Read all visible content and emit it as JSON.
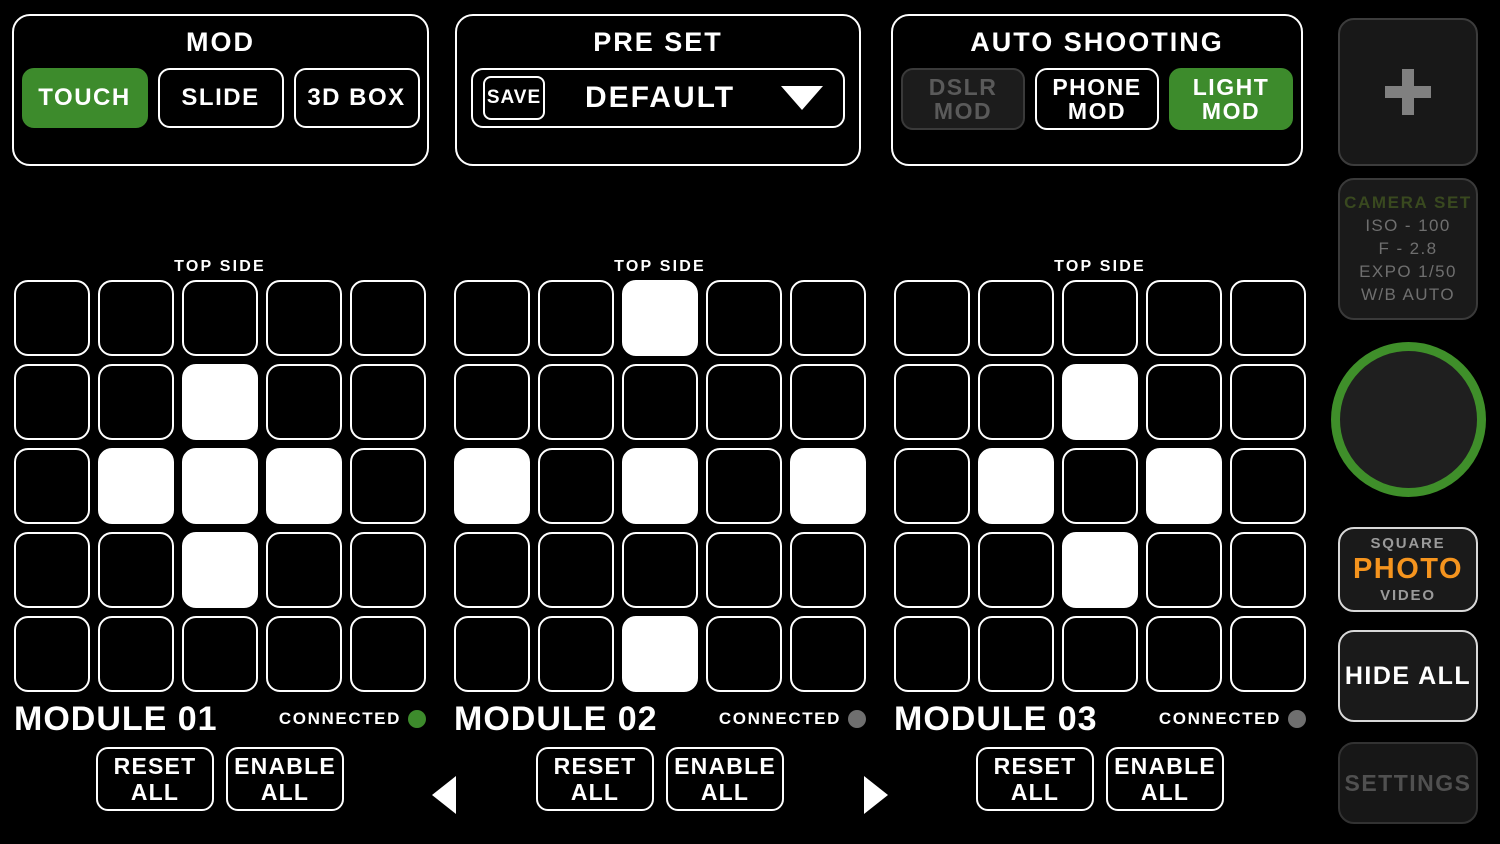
{
  "mod_panel": {
    "title": "MOD",
    "options": [
      {
        "label": "TOUCH",
        "state": "active"
      },
      {
        "label": "SLIDE",
        "state": "normal"
      },
      {
        "label": "3D BOX",
        "state": "normal"
      }
    ]
  },
  "preset_panel": {
    "title": "PRE SET",
    "save_label": "SAVE",
    "selected": "DEFAULT",
    "caret_icon": "chevron-down-icon"
  },
  "auto_panel": {
    "title": "AUTO SHOOTING",
    "options": [
      {
        "line1": "DSLR",
        "line2": "MOD",
        "state": "disabled"
      },
      {
        "line1": "PHONE",
        "line2": "MOD",
        "state": "normal"
      },
      {
        "line1": "LIGHT",
        "line2": "MOD",
        "state": "active"
      }
    ]
  },
  "sidebar": {
    "add_icon": "plus-icon",
    "camera_set": {
      "title": "CAMERA SET",
      "lines": [
        "ISO - 100",
        "F - 2.8",
        "EXPO 1/50",
        "W/B AUTO"
      ]
    },
    "shutter_icon": "shutter-button",
    "capture_mode": {
      "above": "SQUARE",
      "selected": "PHOTO",
      "below": "VIDEO"
    },
    "hide_all_label": "HIDE ALL",
    "settings_label": "SETTINGS"
  },
  "modules": [
    {
      "top_label": "TOP SIDE",
      "name": "MODULE 01",
      "connection_label": "CONNECTED",
      "connected": true,
      "reset_l1": "RESET",
      "reset_l2": "ALL",
      "enable_l1": "ENABLE",
      "enable_l2": "ALL",
      "grid": [
        [
          0,
          0,
          0,
          0,
          0
        ],
        [
          0,
          0,
          1,
          0,
          0
        ],
        [
          0,
          1,
          1,
          1,
          0
        ],
        [
          0,
          0,
          1,
          0,
          0
        ],
        [
          0,
          0,
          0,
          0,
          0
        ]
      ]
    },
    {
      "top_label": "TOP SIDE",
      "name": "MODULE 02",
      "connection_label": "CONNECTED",
      "connected": false,
      "reset_l1": "RESET",
      "reset_l2": "ALL",
      "enable_l1": "ENABLE",
      "enable_l2": "ALL",
      "grid": [
        [
          0,
          0,
          1,
          0,
          0
        ],
        [
          0,
          0,
          0,
          0,
          0
        ],
        [
          1,
          0,
          1,
          0,
          1
        ],
        [
          0,
          0,
          0,
          0,
          0
        ],
        [
          0,
          0,
          1,
          0,
          0
        ]
      ]
    },
    {
      "top_label": "TOP SIDE",
      "name": "MODULE 03",
      "connection_label": "CONNECTED",
      "connected": false,
      "reset_l1": "RESET",
      "reset_l2": "ALL",
      "enable_l1": "ENABLE",
      "enable_l2": "ALL",
      "grid": [
        [
          0,
          0,
          0,
          0,
          0
        ],
        [
          0,
          0,
          1,
          0,
          0
        ],
        [
          0,
          1,
          0,
          1,
          0
        ],
        [
          0,
          0,
          1,
          0,
          0
        ],
        [
          0,
          0,
          0,
          0,
          0
        ]
      ]
    }
  ],
  "nav": {
    "prev_icon": "triangle-left-icon",
    "next_icon": "triangle-right-icon"
  },
  "colors": {
    "accent_green": "#3d8b2c",
    "accent_orange": "#f5941e",
    "connected_dot": "#3d8b2c",
    "disconnected_dot": "#6f6f6f",
    "background": "#000000"
  }
}
